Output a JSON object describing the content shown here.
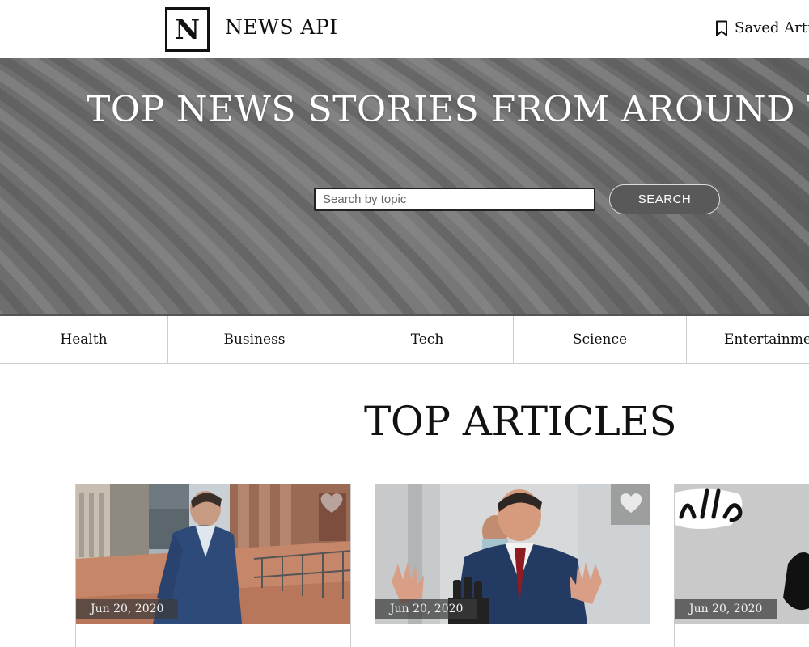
{
  "brand": {
    "logo_letter": "N",
    "name": "NEWS API"
  },
  "nav": {
    "saved_label": "Saved Articles"
  },
  "hero": {
    "title": "TOP NEWS STORIES FROM AROUND THE WORLD",
    "search_placeholder": "Search by topic",
    "search_button": "SEARCH"
  },
  "categories": [
    "Health",
    "Business",
    "Tech",
    "Science",
    "Entertainment"
  ],
  "section_title": "TOP ARTICLES",
  "articles": [
    {
      "date": "Jun 20, 2020",
      "favorite_icon": "heart-icon"
    },
    {
      "date": "Jun 20, 2020",
      "favorite_icon": "heart-icon"
    },
    {
      "date": "Jun 20, 2020",
      "favorite_icon": "heart-icon"
    }
  ],
  "colors": {
    "hero_bg": "#707070",
    "button_bg": "#595959",
    "text": "#111111"
  }
}
